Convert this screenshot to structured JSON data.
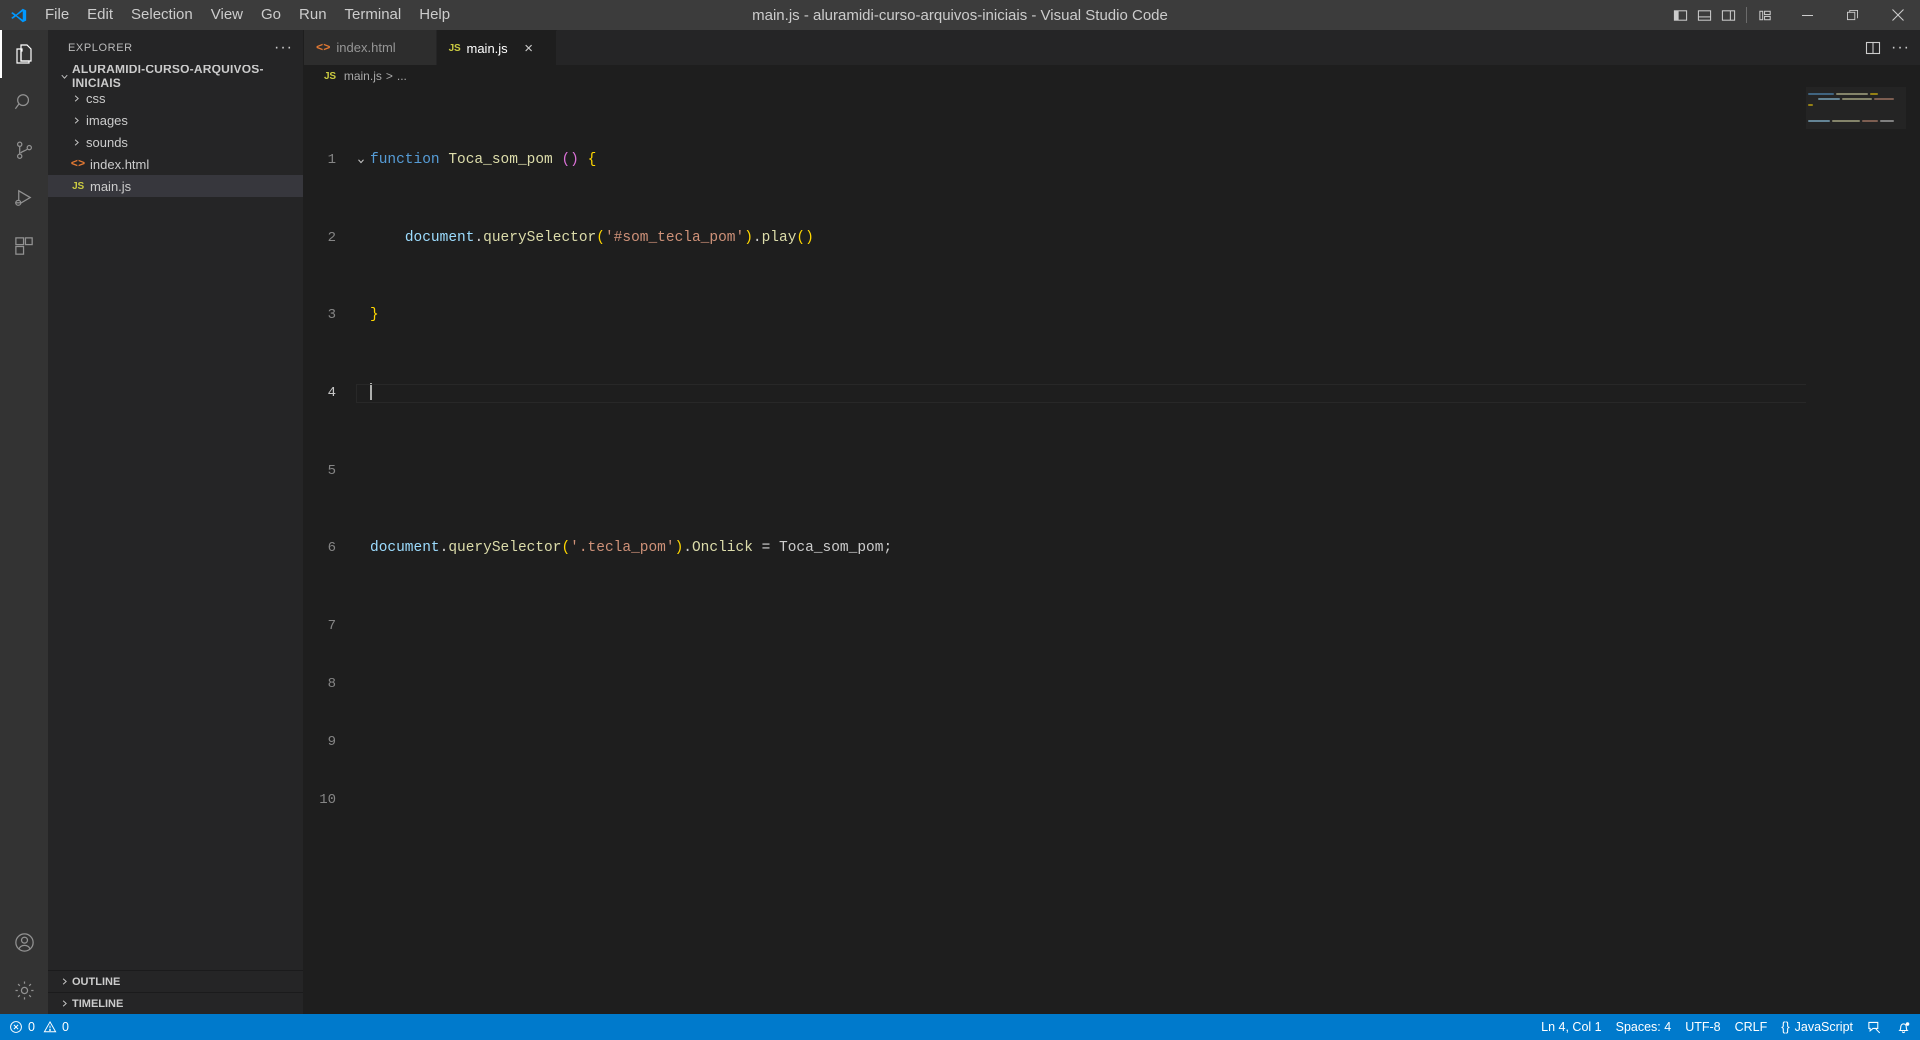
{
  "window": {
    "title": "main.js - aluramidi-curso-arquivos-iniciais - Visual Studio Code",
    "logo_name": "vscode-logo"
  },
  "menubar": {
    "items": [
      {
        "label": "File"
      },
      {
        "label": "Edit"
      },
      {
        "label": "Selection"
      },
      {
        "label": "View"
      },
      {
        "label": "Go"
      },
      {
        "label": "Run"
      },
      {
        "label": "Terminal"
      },
      {
        "label": "Help"
      }
    ]
  },
  "titlebar_actions": {
    "toggle_primary_sidebar": "toggle-primary-sidebar-icon",
    "toggle_panel": "toggle-panel-icon",
    "toggle_secondary_sidebar": "toggle-secondary-sidebar-icon",
    "customize_layout": "customize-layout-icon",
    "minimize": "minimize-icon",
    "maximize": "maximize-icon",
    "close": "close-icon"
  },
  "activitybar": {
    "items": [
      {
        "name": "explorer",
        "icon": "files-icon",
        "active": true
      },
      {
        "name": "search",
        "icon": "search-icon",
        "active": false
      },
      {
        "name": "source-control",
        "icon": "source-control-icon",
        "active": false
      },
      {
        "name": "run-and-debug",
        "icon": "run-debug-icon",
        "active": false
      },
      {
        "name": "extensions",
        "icon": "extensions-icon",
        "active": false
      }
    ],
    "bottom": [
      {
        "name": "accounts",
        "icon": "account-icon"
      },
      {
        "name": "manage",
        "icon": "gear-icon"
      }
    ]
  },
  "sidebar": {
    "title": "EXPLORER",
    "more_actions": "···",
    "root_folder": "ALURAMIDI-CURSO-ARQUIVOS-INICIAIS",
    "tree": [
      {
        "label": "css",
        "type": "folder",
        "expanded": false,
        "selected": false
      },
      {
        "label": "images",
        "type": "folder",
        "expanded": false,
        "selected": false
      },
      {
        "label": "sounds",
        "type": "folder",
        "expanded": false,
        "selected": false
      },
      {
        "label": "index.html",
        "type": "html",
        "expanded": false,
        "selected": false
      },
      {
        "label": "main.js",
        "type": "js",
        "expanded": false,
        "selected": true
      }
    ],
    "sections": [
      {
        "label": "OUTLINE"
      },
      {
        "label": "TIMELINE"
      }
    ]
  },
  "editor": {
    "tabs": [
      {
        "label": "index.html",
        "icon": "html-file-icon",
        "active": false
      },
      {
        "label": "main.js",
        "icon": "js-file-icon",
        "active": true
      }
    ],
    "tab_close_label": "×",
    "actions": {
      "split_editor": "split-editor-icon",
      "more_actions": "···"
    },
    "breadcrumb": {
      "file": "main.js",
      "separator": ">",
      "symbol": "..."
    },
    "line_numbers": [
      "1",
      "2",
      "3",
      "4",
      "5",
      "6",
      "7",
      "8",
      "9",
      "10"
    ],
    "current_line": 4,
    "code_lines": [
      {
        "n": "1",
        "fold": "v",
        "tokens": [
          {
            "t": "function",
            "c": "k"
          },
          {
            "t": " ",
            "c": "p"
          },
          {
            "t": "Toca_som_pom",
            "c": "fn"
          },
          {
            "t": " ",
            "c": "p"
          },
          {
            "t": "(",
            "c": "br2"
          },
          {
            "t": ")",
            "c": "br2"
          },
          {
            "t": " ",
            "c": "p"
          },
          {
            "t": "{",
            "c": "br1"
          }
        ]
      },
      {
        "n": "2",
        "fold": "",
        "indent": 1,
        "tokens": [
          {
            "t": "    ",
            "c": "p"
          },
          {
            "t": "document",
            "c": "var"
          },
          {
            "t": ".",
            "c": "p"
          },
          {
            "t": "querySelector",
            "c": "fn"
          },
          {
            "t": "(",
            "c": "br1"
          },
          {
            "t": "'#som_tecla_pom'",
            "c": "st"
          },
          {
            "t": ")",
            "c": "br1"
          },
          {
            "t": ".",
            "c": "p"
          },
          {
            "t": "play",
            "c": "fn"
          },
          {
            "t": "(",
            "c": "br1"
          },
          {
            "t": ")",
            "c": "br1"
          }
        ]
      },
      {
        "n": "3",
        "fold": "",
        "tokens": [
          {
            "t": "}",
            "c": "br1"
          }
        ]
      },
      {
        "n": "4",
        "fold": "",
        "tokens": []
      },
      {
        "n": "5",
        "fold": "",
        "tokens": []
      },
      {
        "n": "6",
        "fold": "",
        "tokens": [
          {
            "t": "document",
            "c": "var"
          },
          {
            "t": ".",
            "c": "p"
          },
          {
            "t": "querySelector",
            "c": "fn"
          },
          {
            "t": "(",
            "c": "br1"
          },
          {
            "t": "'.tecla_pom'",
            "c": "st"
          },
          {
            "t": ")",
            "c": "br1"
          },
          {
            "t": ".",
            "c": "p"
          },
          {
            "t": "Onclick",
            "c": "fn"
          },
          {
            "t": " ",
            "c": "p"
          },
          {
            "t": "=",
            "c": "op"
          },
          {
            "t": " ",
            "c": "p"
          },
          {
            "t": "Toca_som_pom",
            "c": "p"
          },
          {
            "t": ";",
            "c": "p"
          }
        ]
      },
      {
        "n": "7",
        "fold": "",
        "tokens": []
      },
      {
        "n": "8",
        "fold": "",
        "tokens": []
      },
      {
        "n": "9",
        "fold": "",
        "tokens": []
      },
      {
        "n": "10",
        "fold": "",
        "tokens": []
      }
    ]
  },
  "statusbar": {
    "errors_icon": "error-icon",
    "errors": "0",
    "warnings_icon": "warning-icon",
    "warnings": "0",
    "cursor_position": "Ln 4, Col 1",
    "indentation": "Spaces: 4",
    "encoding": "UTF-8",
    "eol": "CRLF",
    "language_icon": "{}",
    "language": "JavaScript",
    "feedback_icon": "feedback-icon",
    "notifications_icon": "bell-icon"
  },
  "colors": {
    "accent": "#007acc",
    "titlebar_bg": "#3c3c3c",
    "activitybar_bg": "#333333",
    "sidebar_bg": "#252526",
    "editor_bg": "#1e1e1e",
    "selection_bg": "#37373d",
    "js_icon": "#cbcb41",
    "html_icon": "#e37933"
  }
}
